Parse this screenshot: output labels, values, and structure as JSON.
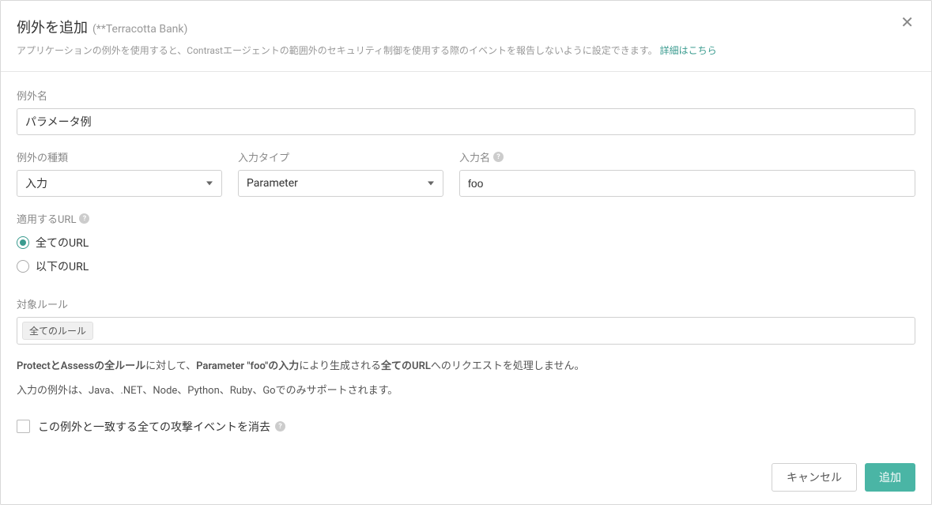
{
  "header": {
    "title": "例外を追加",
    "app_name": "(**Terracotta Bank)",
    "description_prefix": "アプリケーションの例外を使用すると、Contrastエージェントの範囲外のセキュリティ制御を使用する際のイベントを報告しないように設定できます。",
    "description_link": "詳細はこちら"
  },
  "form": {
    "exception_name": {
      "label": "例外名",
      "value": "パラメータ例"
    },
    "exception_type": {
      "label": "例外の種類",
      "value": "入力"
    },
    "input_type": {
      "label": "入力タイプ",
      "value": "Parameter"
    },
    "input_name": {
      "label": "入力名",
      "value": "foo"
    },
    "apply_url": {
      "label": "適用するURL",
      "options": {
        "all": "全てのURL",
        "following": "以下のURL"
      },
      "selected": "all"
    },
    "target_rules": {
      "label": "対象ルール",
      "tag": "全てのルール"
    },
    "info_text": {
      "part1": "ProtectとAssessの全ルール",
      "part2": "に対して、",
      "part3": "Parameter \"foo\"の入力",
      "part4": "により生成される",
      "part5": "全てのURL",
      "part6": "へのリクエストを処理しません。"
    },
    "support_text": "入力の例外は、Java、.NET、Node、Python、Ruby、Goでのみサポートされます。",
    "checkbox": {
      "label": "この例外と一致する全ての攻撃イベントを消去",
      "checked": false
    }
  },
  "footer": {
    "cancel": "キャンセル",
    "add": "追加"
  }
}
